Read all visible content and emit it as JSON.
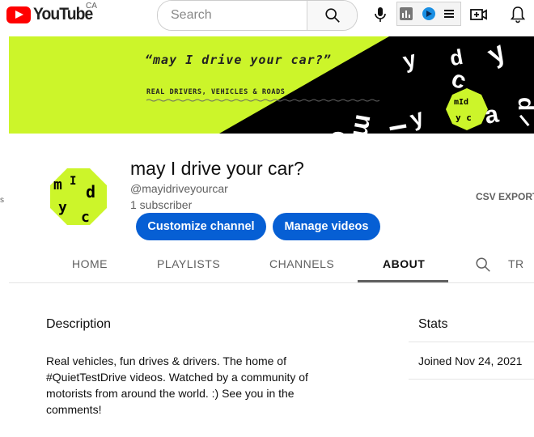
{
  "masthead": {
    "logo_text": "YouTube",
    "country_code": "CA",
    "search_placeholder": "Search"
  },
  "banner": {
    "title": "“may I drive your car?”",
    "subtitle": "REAL DRIVERS, VEHICLES & ROADS"
  },
  "channel": {
    "name": "may I drive your car?",
    "handle": "@mayidriveyourcar",
    "subscribers": "1 subscriber",
    "customize_label": "Customize channel",
    "manage_label": "Manage videos",
    "csv_export": "CSV EXPORT",
    "left_edge_char": "s"
  },
  "tabs": [
    {
      "label": "HOME"
    },
    {
      "label": "PLAYLISTS"
    },
    {
      "label": "CHANNELS"
    },
    {
      "label": "ABOUT",
      "active": true
    }
  ],
  "tab_partial": "TR",
  "about": {
    "description_title": "Description",
    "description_text": "Real vehicles, fun drives & drivers. The home of #QuietTestDrive videos. Watched by a community of motorists from around the world. :) See you in the comments!",
    "stats_title": "Stats",
    "joined": "Joined Nov 24, 2021"
  },
  "colors": {
    "accent_blue": "#065fd4",
    "brand_red": "#ff0000",
    "banner_green": "#ccf52a"
  }
}
